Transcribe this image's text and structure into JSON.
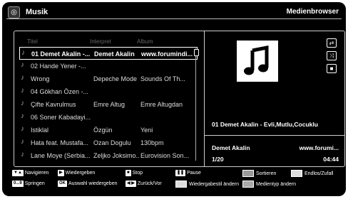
{
  "header": {
    "title": "Musik",
    "browser_label": "Medienbrowser"
  },
  "columns": {
    "title": "Titel",
    "artist": "Interpret",
    "album": "Album"
  },
  "tracks": [
    {
      "title": "01 Demet Akalin -...",
      "artist": "Demet Akalin",
      "album": "www.forumindi..."
    },
    {
      "title": "02 Hande Yener -...",
      "artist": "",
      "album": ""
    },
    {
      "title": "Wrong",
      "artist": "Depeche Mode",
      "album": "Sounds Of Th..."
    },
    {
      "title": "04 Gökhan Özen -...",
      "artist": "",
      "album": ""
    },
    {
      "title": "Çifte Kavrulmus",
      "artist": "Emre Altug",
      "album": "Emre Altugdan"
    },
    {
      "title": "06 Soner Kabadayi...",
      "artist": "",
      "album": ""
    },
    {
      "title": "Istiklal",
      "artist": "Özgün",
      "album": "Yeni"
    },
    {
      "title": "Hata feat. Mustafa...",
      "artist": "Ozan Dogulu",
      "album": "130bpm"
    },
    {
      "title": "Lane Moye (Serbia...",
      "artist": "Zeljko Joksimo...",
      "album": "Eurovision Son..."
    }
  ],
  "now_playing": {
    "title": "01 Demet Akalin - Evli,Mutlu,Cocuklu",
    "artist": "Demet Akalin",
    "album": "www.forumi...",
    "track_position": "1/20",
    "time": "04:44"
  },
  "icons": {
    "repeat": "repeat-icon",
    "shuffle": "shuffle-icon",
    "stop": "stop-square-icon",
    "cover": "music-note-icon"
  },
  "legend": {
    "navigate_key": "▼▲",
    "navigate": "Navigieren",
    "play_key": "▶",
    "play": "Wiedergeben",
    "stop_key": "■",
    "stop": "Stop",
    "pause_key": "❚❚",
    "pause": "Pause",
    "sort": "Sortieren",
    "endless": "Endlos/Zufall",
    "jump_key": "0...9",
    "jump": "Springen",
    "ok_key": "OK",
    "play_selection": "Auswahl wiedergeben",
    "backfwd_key": "◀ ▶",
    "backfwd": "Zurück/Vor",
    "playstyle": "Wiedergabestil ändern",
    "mediatype": "Medientyp ändern"
  },
  "colors": {
    "red": "#e02020",
    "green": "#20b020",
    "yellow": "#e0d000",
    "blue": "#2050e0"
  }
}
